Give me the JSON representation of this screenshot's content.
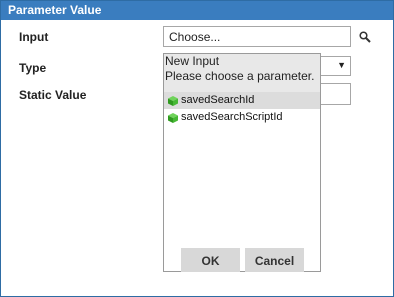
{
  "dialog": {
    "title": "Parameter Value"
  },
  "form": {
    "input_label": "Input",
    "input_value": "Choose...",
    "type_label": "Type",
    "static_value_label": "Static Value"
  },
  "popup": {
    "title": "New Input",
    "subtitle": "Please choose a parameter.",
    "items": [
      {
        "label": "savedSearchId",
        "icon": "green-cube-icon",
        "selected": true
      },
      {
        "label": "savedSearchScriptId",
        "icon": "green-cube-icon",
        "selected": false
      }
    ],
    "ok_label": "OK",
    "cancel_label": "Cancel"
  },
  "colors": {
    "titlebar": "#3a7dbf",
    "selected_row": "#dcdcdc",
    "button": "#d8d8d8"
  }
}
